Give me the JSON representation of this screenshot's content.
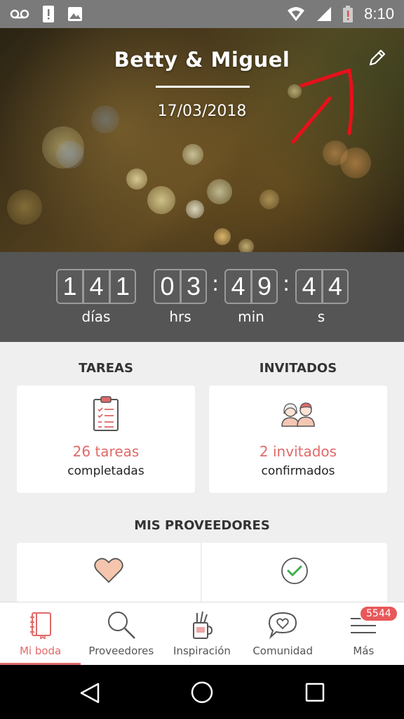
{
  "status_bar": {
    "time": "8:10",
    "icons": [
      "voicemail-icon",
      "alert-icon",
      "image-icon",
      "wifi-icon",
      "signal-icon",
      "battery-alert-icon"
    ]
  },
  "hero": {
    "title": "Betty & Miguel",
    "date": "17/03/2018",
    "edit_icon": "pencil-icon"
  },
  "countdown": {
    "days": [
      "1",
      "4",
      "1"
    ],
    "hours": [
      "0",
      "3"
    ],
    "minutes": [
      "4",
      "9"
    ],
    "seconds": [
      "4",
      "4"
    ],
    "labels": {
      "days": "días",
      "hours": "hrs",
      "minutes": "min",
      "seconds": "s"
    }
  },
  "tasks": {
    "title": "TAREAS",
    "count_text": "26 tareas",
    "sub_text": "completadas",
    "icon": "clipboard-icon"
  },
  "guests": {
    "title": "INVITADOS",
    "count_text": "2 invitados",
    "sub_text": "confirmados",
    "icon": "couple-icon"
  },
  "providers": {
    "title": "MIS PROVEEDORES",
    "icons": [
      "heart-icon",
      "check-circle-icon"
    ]
  },
  "bottom_nav": {
    "items": [
      {
        "label": "Mi boda",
        "icon": "notebook-icon",
        "active": true
      },
      {
        "label": "Proveedores",
        "icon": "search-icon",
        "active": false
      },
      {
        "label": "Inspiración",
        "icon": "pencil-cup-icon",
        "active": false
      },
      {
        "label": "Comunidad",
        "icon": "chat-heart-icon",
        "active": false
      },
      {
        "label": "Más",
        "icon": "menu-icon",
        "active": false
      }
    ],
    "badge": "5544"
  },
  "colors": {
    "accent": "#e06a68",
    "countdown_bg": "#555555",
    "annotation": "#e8101a"
  }
}
